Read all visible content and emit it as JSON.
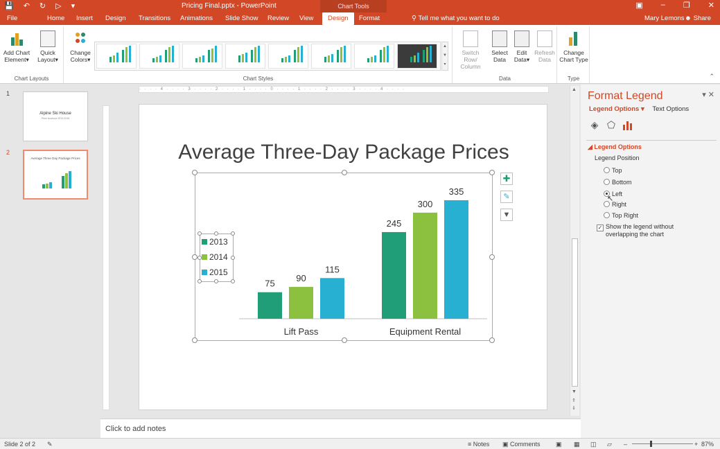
{
  "app": {
    "doc_title": "Pricing Final.pptx - PowerPoint",
    "contextual_tab": "Chart Tools",
    "tell_me": "Tell me what you want to do",
    "user": "Mary Lemons",
    "share": "Share"
  },
  "tabs": [
    "File",
    "Home",
    "Insert",
    "Design",
    "Transitions",
    "Animations",
    "Slide Show",
    "Review",
    "View",
    "Design",
    "Format"
  ],
  "active_tab": "Design",
  "ribbon": {
    "add_chart_element": [
      "Add Chart",
      "Element"
    ],
    "quick_layout": [
      "Quick",
      "Layout"
    ],
    "change_colors": [
      "Change",
      "Colors"
    ],
    "group_chart_layouts": "Chart Layouts",
    "group_chart_styles": "Chart Styles",
    "switch_row_column": [
      "Switch Row/",
      "Column"
    ],
    "select_data": [
      "Select",
      "Data"
    ],
    "edit_data": [
      "Edit",
      "Data"
    ],
    "refresh_data": [
      "Refresh",
      "Data"
    ],
    "group_data": "Data",
    "change_chart_type": [
      "Change",
      "Chart Type"
    ],
    "group_type": "Type"
  },
  "thumbnails": [
    {
      "num": "1",
      "title": "Alpine Ski House",
      "subtitle": "Price brochure 2013-2015"
    },
    {
      "num": "2",
      "title": "Average Three Day Package Prices"
    }
  ],
  "ruler_text": "· · · · 4 · · · · 3 · · · · 2 · · · · 1 · · · · 0 · · · · 1 · · · · 2 · · · · 3 · · · · 4 · · · ·",
  "slide": {
    "title": "Average Three-Day Package Prices"
  },
  "chart_data": {
    "type": "bar",
    "title": "",
    "categories": [
      "Lift Pass",
      "Equipment Rental"
    ],
    "series": [
      {
        "name": "2013",
        "color": "#1f9e78",
        "values": [
          75,
          245
        ]
      },
      {
        "name": "2014",
        "color": "#8cc13f",
        "values": [
          90,
          300
        ]
      },
      {
        "name": "2015",
        "color": "#27b0d2",
        "values": [
          115,
          335
        ]
      }
    ],
    "ylim": [
      0,
      335
    ],
    "legend_position": "left",
    "grid": false
  },
  "notes_placeholder": "Click to add notes",
  "pane": {
    "title": "Format Legend",
    "tab_legend_options": "Legend Options",
    "tab_text_options": "Text Options",
    "section": "Legend Options",
    "legend_position_label": "Legend Position",
    "positions": [
      "Top",
      "Bottom",
      "Left",
      "Right",
      "Top Right"
    ],
    "selected_position": "Left",
    "show_without_overlap": "Show the legend without overlapping the chart",
    "show_without_overlap_checked": true
  },
  "status": {
    "slide_info": "Slide 2 of 2",
    "notes": "Notes",
    "comments": "Comments",
    "zoom": "87%"
  },
  "colors": {
    "accent": "#d24726"
  }
}
